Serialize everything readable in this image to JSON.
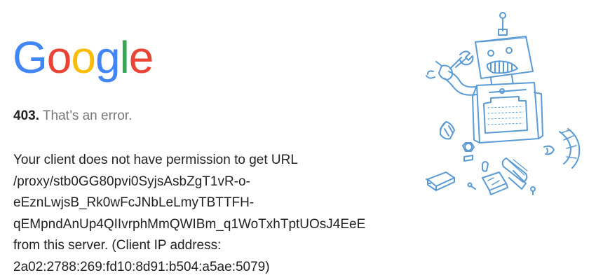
{
  "logo": {
    "text": "Google",
    "letters": [
      {
        "char": "G",
        "color": "#4285F4"
      },
      {
        "char": "o",
        "color": "#EA4335"
      },
      {
        "char": "o",
        "color": "#FBBC05"
      },
      {
        "char": "g",
        "color": "#4285F4"
      },
      {
        "char": "l",
        "color": "#34A853"
      },
      {
        "char": "e",
        "color": "#EA4335"
      }
    ]
  },
  "error": {
    "code": "403.",
    "label": "That’s an error."
  },
  "message": {
    "lines": [
      "Your client does not have permission to get URL",
      "/proxy/stb0GG80pvi0SyjsAsbZgT1vR-o-",
      "eEznLwjsB_Rk0wFcJNbLeLmyTBTTFH-",
      "qEMpndAnUp4QIIvrphMmQWIBm_q1WoTxhTptUOsJ4EeE",
      "from this server. (Client IP address:",
      "2a02:2788:269:fd10:8d91:b504:a5ae:5079)"
    ]
  },
  "illustration": {
    "name": "broken-robot-illustration",
    "stroke_color": "#5B9BD5"
  }
}
